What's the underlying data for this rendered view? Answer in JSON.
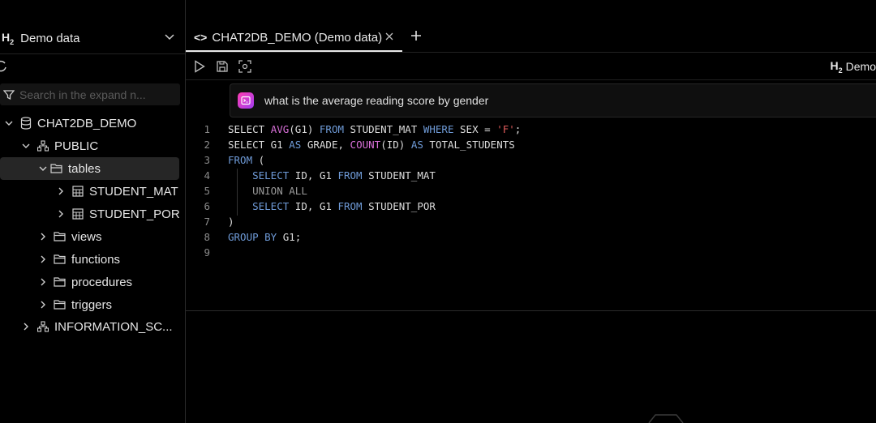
{
  "sidebar": {
    "db_badge": "H",
    "db_badge_sub": "2",
    "db_name": "Demo data",
    "search_placeholder": "Search in the expand n...",
    "tree": {
      "root": "CHAT2DB_DEMO",
      "schema": "PUBLIC",
      "tables": "tables",
      "table1": "STUDENT_MAT",
      "table2": "STUDENT_POR",
      "views": "views",
      "functions": "functions",
      "procedures": "procedures",
      "triggers": "triggers",
      "info_schema": "INFORMATION_SC..."
    }
  },
  "tab": {
    "icon": "<>",
    "title": "CHAT2DB_DEMO (Demo data)"
  },
  "toolbar": {
    "db_badge": "H",
    "db_badge_sub": "2",
    "db_name": "Demo"
  },
  "prompt": {
    "text": "what is the average reading score by gender"
  },
  "editor": {
    "line_numbers": [
      "1",
      "2",
      "3",
      "4",
      "5",
      "6",
      "7",
      "8",
      "9"
    ]
  },
  "colors": {
    "keyword": "#6f9bd8",
    "function": "#d970d9",
    "string": "#e05b5b",
    "accent_start": "#ff3fb3",
    "accent_end": "#a13cf0"
  }
}
